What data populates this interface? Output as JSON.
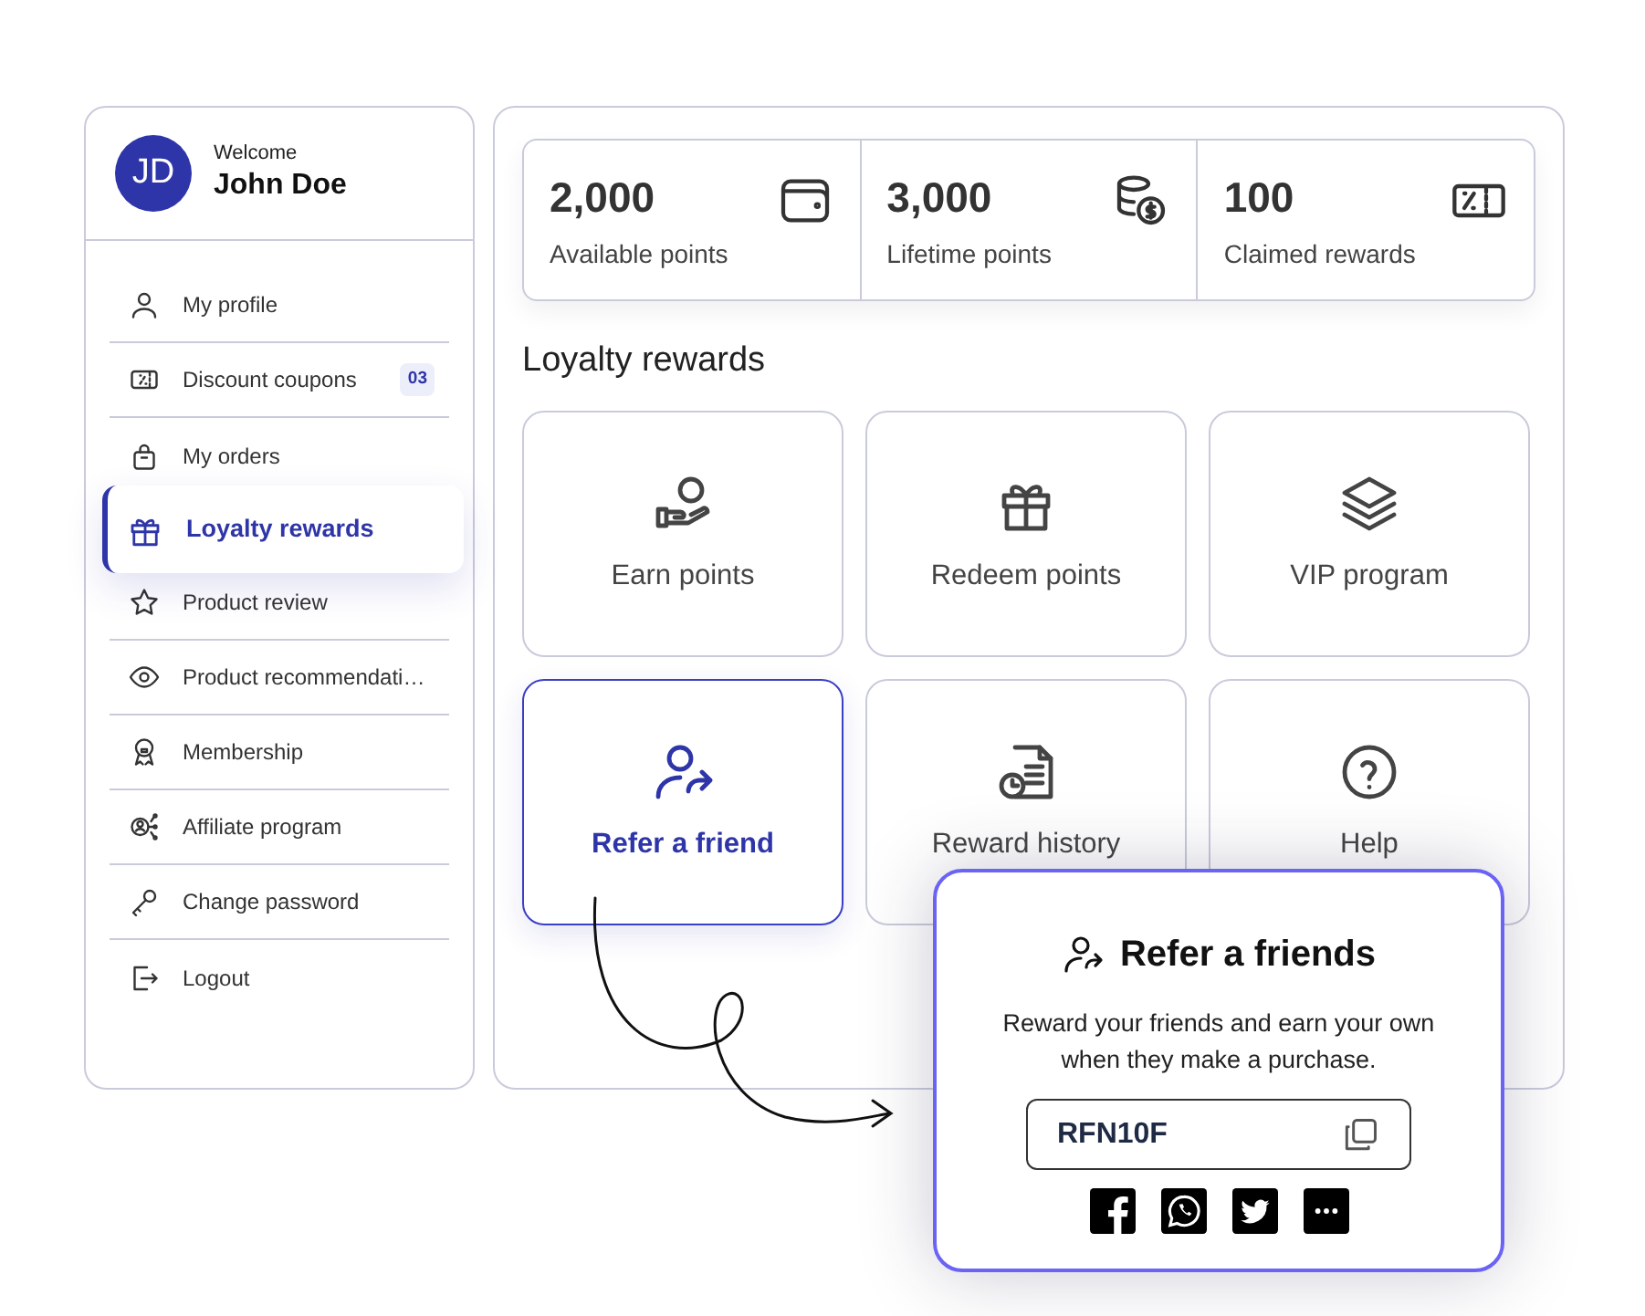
{
  "user": {
    "initials": "JD",
    "greeting": "Welcome",
    "name": "John Doe"
  },
  "menu": [
    {
      "label": "My profile",
      "selected": false
    },
    {
      "label": "Discount coupons",
      "selected": false,
      "badge": "03"
    },
    {
      "label": "My orders",
      "selected": false
    },
    {
      "label": "Loyalty rewards",
      "selected": true
    },
    {
      "label": "Product review",
      "selected": false
    },
    {
      "label": "Product recommendati…",
      "selected": false
    },
    {
      "label": "Membership",
      "selected": false
    },
    {
      "label": "Affiliate program",
      "selected": false
    },
    {
      "label": "Change password",
      "selected": false
    },
    {
      "label": "Logout",
      "selected": false
    }
  ],
  "stats": [
    {
      "value": "2,000",
      "label": "Available points"
    },
    {
      "value": "3,000",
      "label": "Lifetime points"
    },
    {
      "value": "100",
      "label": "Claimed rewards"
    }
  ],
  "section_title": "Loyalty rewards",
  "tiles": [
    {
      "label": "Earn points",
      "selected": false
    },
    {
      "label": "Redeem points",
      "selected": false
    },
    {
      "label": "VIP program",
      "selected": false
    },
    {
      "label": "Refer a friend",
      "selected": true
    },
    {
      "label": "Reward history",
      "selected": false
    },
    {
      "label": "Help",
      "selected": false
    }
  ],
  "popup": {
    "title": "Refer a friends",
    "text": "Reward your friends and earn your own when they make a purchase.",
    "code": "RFN10F"
  }
}
